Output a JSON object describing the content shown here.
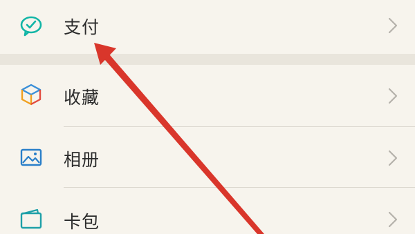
{
  "menu": {
    "items": [
      {
        "label": "支付",
        "icon": "wechat-pay-icon"
      },
      {
        "label": "收藏",
        "icon": "favorites-cube-icon"
      },
      {
        "label": "相册",
        "icon": "album-picture-icon"
      },
      {
        "label": "卡包",
        "icon": "card-wallet-icon"
      }
    ]
  },
  "colors": {
    "background": "#f7f4ed",
    "section_gap": "#e9e5dc",
    "text": "#2b2b2b",
    "chevron": "#b5b2ab",
    "pay_icon": "#12b5a6",
    "arrow": "#d9362b"
  }
}
